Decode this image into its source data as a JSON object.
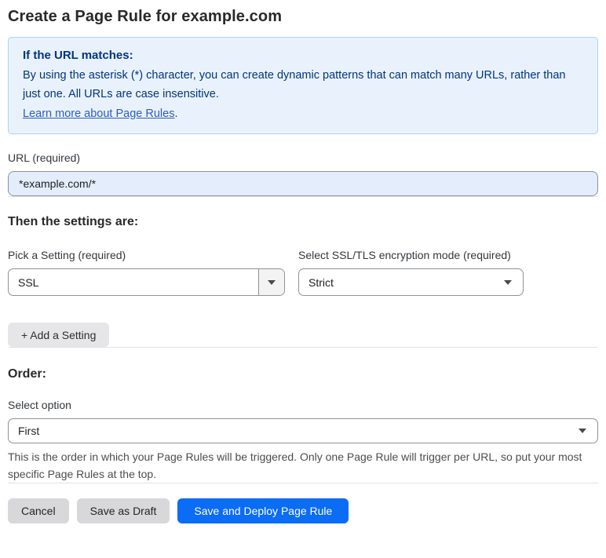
{
  "page": {
    "title": "Create a Page Rule for example.com"
  },
  "info_box": {
    "heading": "If the URL matches:",
    "body": "By using the asterisk (*) character, you can create dynamic patterns that can match many URLs, rather than just one. All URLs are case insensitive.",
    "link_label": "Learn more about Page Rules",
    "link_suffix": "."
  },
  "url_field": {
    "label": "URL (required)",
    "value": "*example.com/*"
  },
  "settings_section": {
    "heading": "Then the settings are:",
    "pick_setting": {
      "label": "Pick a Setting (required)",
      "value": "SSL"
    },
    "ssl_mode": {
      "label": "Select SSL/TLS encryption mode (required)",
      "value": "Strict"
    },
    "add_setting_label": "+ Add a Setting"
  },
  "order_section": {
    "heading": "Order:",
    "select_label": "Select option",
    "value": "First",
    "help_text": "This is the order in which your Page Rules will be triggered. Only one Page Rule will trigger per URL, so put your most specific Page Rules at the top."
  },
  "footer": {
    "cancel_label": "Cancel",
    "save_draft_label": "Save as Draft",
    "save_deploy_label": "Save and Deploy Page Rule"
  },
  "colors": {
    "accent_blue": "#0b6cf5",
    "info_background": "#e9f2fc",
    "info_border": "#abd2ee",
    "info_text": "#003580",
    "link_blue": "#2d5cc5",
    "url_input_background": "#e3edfb"
  }
}
